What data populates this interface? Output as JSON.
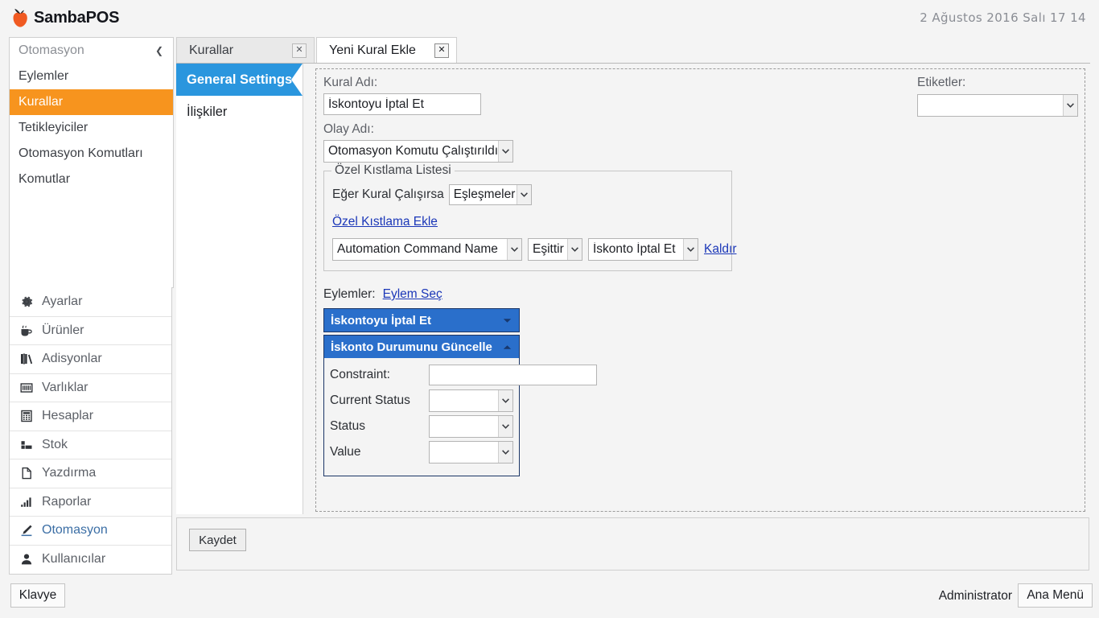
{
  "app": {
    "brand": "SambaPOS",
    "clock": "2 Ağustos 2016 Salı 17 14",
    "accent_orange": "#f7941e",
    "accent_blue": "#2a96de",
    "expander_blue": "#2a6fcb",
    "link_blue": "#1b37b8"
  },
  "sidebar": {
    "header": {
      "label": "Otomasyon",
      "collapse_icon": "chevron-left-icon"
    },
    "items": [
      {
        "label": "Eylemler",
        "active": false
      },
      {
        "label": "Kurallar",
        "active": true
      },
      {
        "label": "Tetikleyiciler",
        "active": false
      },
      {
        "label": "Otomasyon Komutları",
        "active": false
      },
      {
        "label": "Komutlar",
        "active": false
      }
    ],
    "modules": [
      {
        "label": "Ayarlar",
        "icon": "gear-icon",
        "active": false
      },
      {
        "label": "Ürünler",
        "icon": "cup-icon",
        "active": false
      },
      {
        "label": "Adisyonlar",
        "icon": "books-icon",
        "active": false
      },
      {
        "label": "Varlıklar",
        "icon": "grid-icon",
        "active": false
      },
      {
        "label": "Hesaplar",
        "icon": "calculator-icon",
        "active": false
      },
      {
        "label": "Stok",
        "icon": "boxes-icon",
        "active": false
      },
      {
        "label": "Yazdırma",
        "icon": "page-icon",
        "active": false
      },
      {
        "label": "Raporlar",
        "icon": "bar-chart-icon",
        "active": false
      },
      {
        "label": "Otomasyon",
        "icon": "pen-icon",
        "active": true
      },
      {
        "label": "Kullanıcılar",
        "icon": "user-icon",
        "active": false
      }
    ]
  },
  "tabs": [
    {
      "label": "Kurallar",
      "selected": false,
      "close_icon": "close-icon"
    },
    {
      "label": "Yeni Kural Ekle",
      "selected": true,
      "close_icon": "close-icon"
    }
  ],
  "vtabs": [
    {
      "label": "General Settings",
      "selected": true
    },
    {
      "label": "İlişkiler",
      "selected": false
    }
  ],
  "form": {
    "rule_name_label": "Kural Adı:",
    "rule_name_value": "İskontoyu İptal Et",
    "event_name_label": "Olay Adı:",
    "event_name_value": "Otomasyon Komutu Çalıştırıldı",
    "tags_label": "Etiketler:",
    "tags_value": "",
    "constraint_group": {
      "title": "Özel Kıstlama Listesi",
      "if_rule_label": "Eğer Kural Çalışırsa",
      "match_value": "Eşleşmeler",
      "add_link": "Özel Kıstlama Ekle",
      "rows": [
        {
          "field": "Automation Command Name",
          "operator": "Eşittir",
          "value": "İskonto İptal Et",
          "remove_link": "Kaldır"
        }
      ]
    },
    "actions_label": "Eylemler:",
    "select_action_link": "Eylem Seç",
    "action_panels": [
      {
        "title": "İskontoyu İptal Et",
        "expanded": false,
        "caret_icon": "chevron-down-icon",
        "fields": []
      },
      {
        "title": "İskonto Durumunu Güncelle",
        "expanded": true,
        "caret_icon": "chevron-up-icon",
        "fields": [
          {
            "label": "Constraint:",
            "type": "textbox",
            "value": ""
          },
          {
            "label": "Current Status",
            "type": "combo",
            "value": ""
          },
          {
            "label": "Status",
            "type": "combo",
            "value": ""
          },
          {
            "label": "Value",
            "type": "combo",
            "value": ""
          }
        ]
      }
    ],
    "save_label": "Kaydet"
  },
  "statusbar": {
    "keyboard_label": "Klavye",
    "user": "Administrator",
    "main_menu_label": "Ana Menü"
  }
}
